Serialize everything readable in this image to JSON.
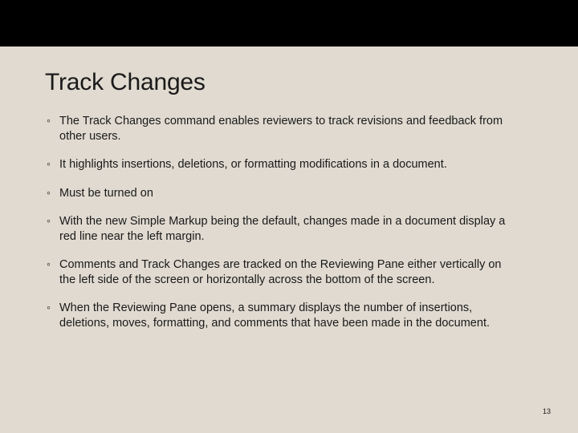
{
  "slide": {
    "title": "Track Changes",
    "bullets": [
      "The Track Changes command enables reviewers to track revisions and feedback from other users.",
      "It highlights insertions, deletions, or formatting modifications in a document.",
      "Must be turned on",
      "With the new Simple Markup being the default, changes made in a document display a red line near the left margin.",
      "Comments and Track Changes are tracked on the Reviewing Pane either vertically on the left side of the screen or horizontally across the bottom of the screen.",
      "When the Reviewing Pane opens, a summary displays the number of insertions, deletions, moves, formatting, and comments that have been made in the document."
    ],
    "page_number": "13"
  }
}
